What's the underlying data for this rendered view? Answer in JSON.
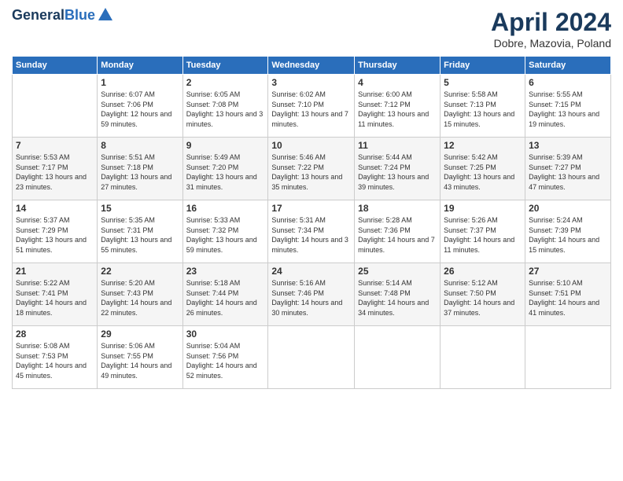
{
  "header": {
    "logo_line1": "General",
    "logo_line2": "Blue",
    "title": "April 2024",
    "subtitle": "Dobre, Mazovia, Poland"
  },
  "columns": [
    "Sunday",
    "Monday",
    "Tuesday",
    "Wednesday",
    "Thursday",
    "Friday",
    "Saturday"
  ],
  "weeks": [
    [
      {
        "day": "",
        "sunrise": "",
        "sunset": "",
        "daylight": "",
        "empty": true
      },
      {
        "day": "1",
        "sunrise": "Sunrise: 6:07 AM",
        "sunset": "Sunset: 7:06 PM",
        "daylight": "Daylight: 12 hours and 59 minutes."
      },
      {
        "day": "2",
        "sunrise": "Sunrise: 6:05 AM",
        "sunset": "Sunset: 7:08 PM",
        "daylight": "Daylight: 13 hours and 3 minutes."
      },
      {
        "day": "3",
        "sunrise": "Sunrise: 6:02 AM",
        "sunset": "Sunset: 7:10 PM",
        "daylight": "Daylight: 13 hours and 7 minutes."
      },
      {
        "day": "4",
        "sunrise": "Sunrise: 6:00 AM",
        "sunset": "Sunset: 7:12 PM",
        "daylight": "Daylight: 13 hours and 11 minutes."
      },
      {
        "day": "5",
        "sunrise": "Sunrise: 5:58 AM",
        "sunset": "Sunset: 7:13 PM",
        "daylight": "Daylight: 13 hours and 15 minutes."
      },
      {
        "day": "6",
        "sunrise": "Sunrise: 5:55 AM",
        "sunset": "Sunset: 7:15 PM",
        "daylight": "Daylight: 13 hours and 19 minutes."
      }
    ],
    [
      {
        "day": "7",
        "sunrise": "Sunrise: 5:53 AM",
        "sunset": "Sunset: 7:17 PM",
        "daylight": "Daylight: 13 hours and 23 minutes."
      },
      {
        "day": "8",
        "sunrise": "Sunrise: 5:51 AM",
        "sunset": "Sunset: 7:18 PM",
        "daylight": "Daylight: 13 hours and 27 minutes."
      },
      {
        "day": "9",
        "sunrise": "Sunrise: 5:49 AM",
        "sunset": "Sunset: 7:20 PM",
        "daylight": "Daylight: 13 hours and 31 minutes."
      },
      {
        "day": "10",
        "sunrise": "Sunrise: 5:46 AM",
        "sunset": "Sunset: 7:22 PM",
        "daylight": "Daylight: 13 hours and 35 minutes."
      },
      {
        "day": "11",
        "sunrise": "Sunrise: 5:44 AM",
        "sunset": "Sunset: 7:24 PM",
        "daylight": "Daylight: 13 hours and 39 minutes."
      },
      {
        "day": "12",
        "sunrise": "Sunrise: 5:42 AM",
        "sunset": "Sunset: 7:25 PM",
        "daylight": "Daylight: 13 hours and 43 minutes."
      },
      {
        "day": "13",
        "sunrise": "Sunrise: 5:39 AM",
        "sunset": "Sunset: 7:27 PM",
        "daylight": "Daylight: 13 hours and 47 minutes."
      }
    ],
    [
      {
        "day": "14",
        "sunrise": "Sunrise: 5:37 AM",
        "sunset": "Sunset: 7:29 PM",
        "daylight": "Daylight: 13 hours and 51 minutes."
      },
      {
        "day": "15",
        "sunrise": "Sunrise: 5:35 AM",
        "sunset": "Sunset: 7:31 PM",
        "daylight": "Daylight: 13 hours and 55 minutes."
      },
      {
        "day": "16",
        "sunrise": "Sunrise: 5:33 AM",
        "sunset": "Sunset: 7:32 PM",
        "daylight": "Daylight: 13 hours and 59 minutes."
      },
      {
        "day": "17",
        "sunrise": "Sunrise: 5:31 AM",
        "sunset": "Sunset: 7:34 PM",
        "daylight": "Daylight: 14 hours and 3 minutes."
      },
      {
        "day": "18",
        "sunrise": "Sunrise: 5:28 AM",
        "sunset": "Sunset: 7:36 PM",
        "daylight": "Daylight: 14 hours and 7 minutes."
      },
      {
        "day": "19",
        "sunrise": "Sunrise: 5:26 AM",
        "sunset": "Sunset: 7:37 PM",
        "daylight": "Daylight: 14 hours and 11 minutes."
      },
      {
        "day": "20",
        "sunrise": "Sunrise: 5:24 AM",
        "sunset": "Sunset: 7:39 PM",
        "daylight": "Daylight: 14 hours and 15 minutes."
      }
    ],
    [
      {
        "day": "21",
        "sunrise": "Sunrise: 5:22 AM",
        "sunset": "Sunset: 7:41 PM",
        "daylight": "Daylight: 14 hours and 18 minutes."
      },
      {
        "day": "22",
        "sunrise": "Sunrise: 5:20 AM",
        "sunset": "Sunset: 7:43 PM",
        "daylight": "Daylight: 14 hours and 22 minutes."
      },
      {
        "day": "23",
        "sunrise": "Sunrise: 5:18 AM",
        "sunset": "Sunset: 7:44 PM",
        "daylight": "Daylight: 14 hours and 26 minutes."
      },
      {
        "day": "24",
        "sunrise": "Sunrise: 5:16 AM",
        "sunset": "Sunset: 7:46 PM",
        "daylight": "Daylight: 14 hours and 30 minutes."
      },
      {
        "day": "25",
        "sunrise": "Sunrise: 5:14 AM",
        "sunset": "Sunset: 7:48 PM",
        "daylight": "Daylight: 14 hours and 34 minutes."
      },
      {
        "day": "26",
        "sunrise": "Sunrise: 5:12 AM",
        "sunset": "Sunset: 7:50 PM",
        "daylight": "Daylight: 14 hours and 37 minutes."
      },
      {
        "day": "27",
        "sunrise": "Sunrise: 5:10 AM",
        "sunset": "Sunset: 7:51 PM",
        "daylight": "Daylight: 14 hours and 41 minutes."
      }
    ],
    [
      {
        "day": "28",
        "sunrise": "Sunrise: 5:08 AM",
        "sunset": "Sunset: 7:53 PM",
        "daylight": "Daylight: 14 hours and 45 minutes."
      },
      {
        "day": "29",
        "sunrise": "Sunrise: 5:06 AM",
        "sunset": "Sunset: 7:55 PM",
        "daylight": "Daylight: 14 hours and 49 minutes."
      },
      {
        "day": "30",
        "sunrise": "Sunrise: 5:04 AM",
        "sunset": "Sunset: 7:56 PM",
        "daylight": "Daylight: 14 hours and 52 minutes."
      },
      {
        "day": "",
        "sunrise": "",
        "sunset": "",
        "daylight": "",
        "empty": true
      },
      {
        "day": "",
        "sunrise": "",
        "sunset": "",
        "daylight": "",
        "empty": true
      },
      {
        "day": "",
        "sunrise": "",
        "sunset": "",
        "daylight": "",
        "empty": true
      },
      {
        "day": "",
        "sunrise": "",
        "sunset": "",
        "daylight": "",
        "empty": true
      }
    ]
  ]
}
